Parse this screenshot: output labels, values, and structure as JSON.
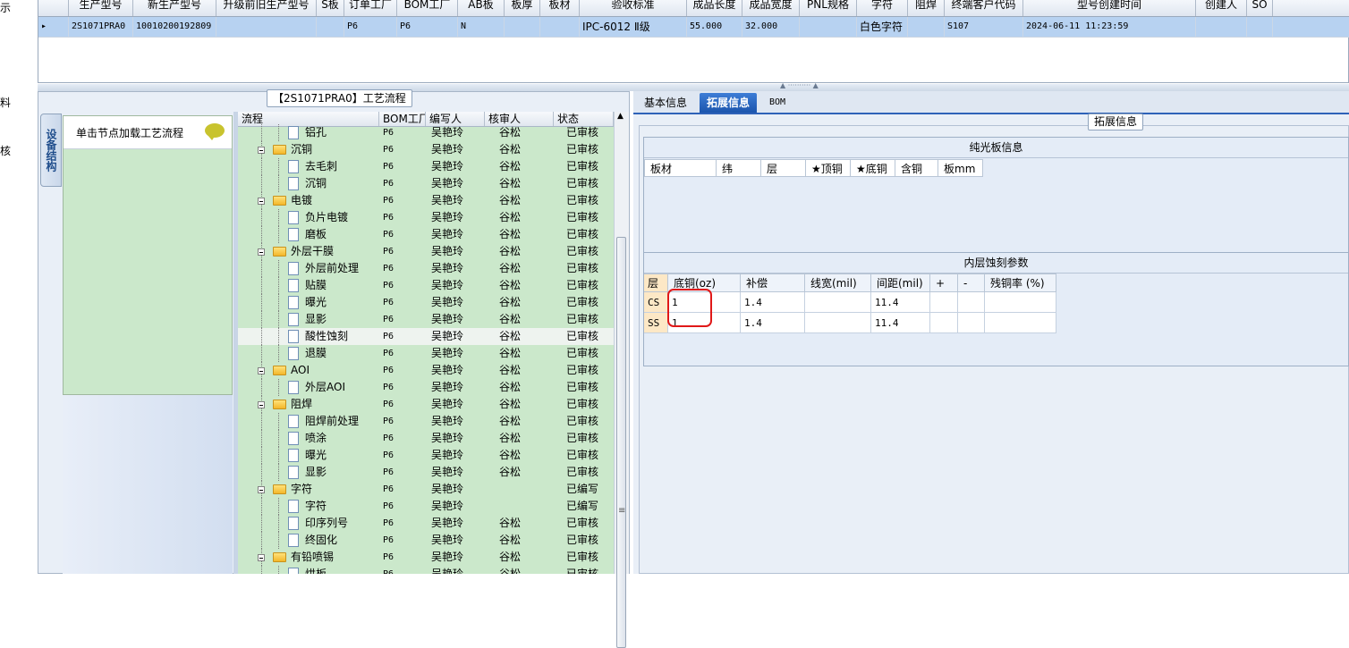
{
  "left_strip": [
    "示",
    "料",
    "核"
  ],
  "top_grid": {
    "columns": [
      "生产型号",
      "新生产型号",
      "升级前旧生产型号",
      "S板",
      "订单工厂",
      "BOM工厂",
      "AB板",
      "板厚",
      "板材",
      "验收标准",
      "成品长度",
      "成品宽度",
      "PNL规格",
      "字符",
      "阻焊",
      "终端客户代码",
      "型号创建时间",
      "创建人",
      "SO"
    ],
    "row": {
      "indicator": "▸",
      "cells": [
        "2S1071PRA0",
        "10010200192809",
        "",
        "",
        "P6",
        "P6",
        "N",
        "",
        "",
        "IPC-6012 Ⅱ级",
        "55.000",
        "32.000",
        "",
        "白色字符",
        "",
        "S107",
        "2024-06-11 11:23:59",
        "",
        ""
      ]
    }
  },
  "left_panel": {
    "title": "【2S1071PRA0】工艺流程",
    "vertical_tab": "设备结构",
    "load_hint": "单击节点加载工艺流程",
    "tree": {
      "columns": [
        "流程",
        "BOM工厂",
        "编写人",
        "核审人",
        "状态"
      ],
      "rows": [
        {
          "level": 1,
          "type": "doc",
          "name": "铝孔",
          "factory": "P6",
          "author": "吴艳玲",
          "reviewer": "谷松",
          "status": "已审核"
        },
        {
          "level": 0,
          "type": "folder",
          "name": "沉铜",
          "factory": "P6",
          "author": "吴艳玲",
          "reviewer": "谷松",
          "status": "已审核"
        },
        {
          "level": 1,
          "type": "doc",
          "name": "去毛刺",
          "factory": "P6",
          "author": "吴艳玲",
          "reviewer": "谷松",
          "status": "已审核"
        },
        {
          "level": 1,
          "type": "doc",
          "name": "沉铜",
          "factory": "P6",
          "author": "吴艳玲",
          "reviewer": "谷松",
          "status": "已审核"
        },
        {
          "level": 0,
          "type": "folder",
          "name": "电镀",
          "factory": "P6",
          "author": "吴艳玲",
          "reviewer": "谷松",
          "status": "已审核"
        },
        {
          "level": 1,
          "type": "doc",
          "name": "负片电镀",
          "factory": "P6",
          "author": "吴艳玲",
          "reviewer": "谷松",
          "status": "已审核"
        },
        {
          "level": 1,
          "type": "doc",
          "name": "磨板",
          "factory": "P6",
          "author": "吴艳玲",
          "reviewer": "谷松",
          "status": "已审核"
        },
        {
          "level": 0,
          "type": "folder",
          "name": "外层干膜",
          "factory": "P6",
          "author": "吴艳玲",
          "reviewer": "谷松",
          "status": "已审核"
        },
        {
          "level": 1,
          "type": "doc",
          "name": "外层前处理",
          "factory": "P6",
          "author": "吴艳玲",
          "reviewer": "谷松",
          "status": "已审核"
        },
        {
          "level": 1,
          "type": "doc",
          "name": "贴膜",
          "factory": "P6",
          "author": "吴艳玲",
          "reviewer": "谷松",
          "status": "已审核"
        },
        {
          "level": 1,
          "type": "doc",
          "name": "曝光",
          "factory": "P6",
          "author": "吴艳玲",
          "reviewer": "谷松",
          "status": "已审核"
        },
        {
          "level": 1,
          "type": "doc",
          "name": "显影",
          "factory": "P6",
          "author": "吴艳玲",
          "reviewer": "谷松",
          "status": "已审核"
        },
        {
          "level": 1,
          "type": "doc",
          "name": "酸性蚀刻",
          "factory": "P6",
          "author": "吴艳玲",
          "reviewer": "谷松",
          "status": "已审核",
          "selected": true
        },
        {
          "level": 1,
          "type": "doc",
          "name": "退膜",
          "factory": "P6",
          "author": "吴艳玲",
          "reviewer": "谷松",
          "status": "已审核"
        },
        {
          "level": 0,
          "type": "folder",
          "name": "AOI",
          "factory": "P6",
          "author": "吴艳玲",
          "reviewer": "谷松",
          "status": "已审核"
        },
        {
          "level": 1,
          "type": "doc",
          "name": "外层AOI",
          "factory": "P6",
          "author": "吴艳玲",
          "reviewer": "谷松",
          "status": "已审核"
        },
        {
          "level": 0,
          "type": "folder",
          "name": "阻焊",
          "factory": "P6",
          "author": "吴艳玲",
          "reviewer": "谷松",
          "status": "已审核"
        },
        {
          "level": 1,
          "type": "doc",
          "name": "阻焊前处理",
          "factory": "P6",
          "author": "吴艳玲",
          "reviewer": "谷松",
          "status": "已审核"
        },
        {
          "level": 1,
          "type": "doc",
          "name": "喷涂",
          "factory": "P6",
          "author": "吴艳玲",
          "reviewer": "谷松",
          "status": "已审核"
        },
        {
          "level": 1,
          "type": "doc",
          "name": "曝光",
          "factory": "P6",
          "author": "吴艳玲",
          "reviewer": "谷松",
          "status": "已审核"
        },
        {
          "level": 1,
          "type": "doc",
          "name": "显影",
          "factory": "P6",
          "author": "吴艳玲",
          "reviewer": "谷松",
          "status": "已审核"
        },
        {
          "level": 0,
          "type": "folder",
          "name": "字符",
          "factory": "P6",
          "author": "吴艳玲",
          "reviewer": "",
          "status": "已编写"
        },
        {
          "level": 1,
          "type": "doc",
          "name": "字符",
          "factory": "P6",
          "author": "吴艳玲",
          "reviewer": "",
          "status": "已编写"
        },
        {
          "level": 1,
          "type": "doc",
          "name": "印序列号",
          "factory": "P6",
          "author": "吴艳玲",
          "reviewer": "谷松",
          "status": "已审核"
        },
        {
          "level": 1,
          "type": "doc",
          "name": "终固化",
          "factory": "P6",
          "author": "吴艳玲",
          "reviewer": "谷松",
          "status": "已审核"
        },
        {
          "level": 0,
          "type": "folder",
          "name": "有铅喷锡",
          "factory": "P6",
          "author": "吴艳玲",
          "reviewer": "谷松",
          "status": "已审核"
        },
        {
          "level": 1,
          "type": "doc",
          "name": "烘板",
          "factory": "P6",
          "author": "吴艳玲",
          "reviewer": "谷松",
          "status": "已审核"
        }
      ]
    }
  },
  "right_panel": {
    "tabs": [
      "基本信息",
      "拓展信息",
      "BOM"
    ],
    "active_tab": 1,
    "ext_title": "拓展信息",
    "pure_board": {
      "title": "纯光板信息",
      "columns": [
        "板材",
        "纬",
        "层",
        "★顶铜",
        "★底铜",
        "含铜",
        "板mm"
      ]
    },
    "inner_etch": {
      "title": "内层蚀刻参数",
      "columns": [
        "层",
        "底铜(oz)",
        "补偿",
        "线宽(mil)",
        "间距(mil)",
        "+",
        "-",
        "残铜率 (%)"
      ],
      "rows": [
        [
          "CS",
          "1",
          "1.4",
          "",
          "11.4",
          "",
          "",
          ""
        ],
        [
          "SS",
          "1",
          "1.4",
          "",
          "11.4",
          "",
          "",
          ""
        ]
      ]
    }
  },
  "colors": {
    "selection_blue": "#b7d2f1",
    "tree_green": "#cbe8cb",
    "tab_active": "#1c55ad",
    "highlight_red": "#e01818",
    "row_header": "#fde8c6"
  }
}
